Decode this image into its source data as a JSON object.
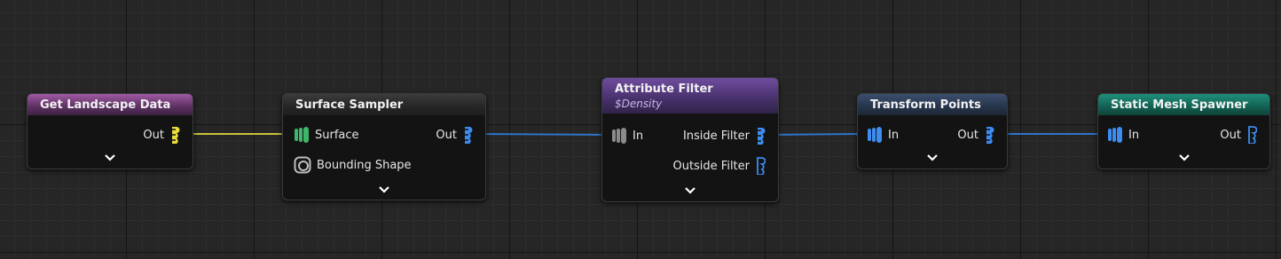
{
  "graph": {
    "nodes": [
      {
        "id": "get_landscape_data",
        "title": "Get Landscape Data",
        "header_color": "#a05aa4",
        "outputs": [
          {
            "label": "Out",
            "color": "#e8dc3a",
            "icon": "point-data-pin-icon"
          }
        ],
        "expand_icon": "chevron-down-icon"
      },
      {
        "id": "surface_sampler",
        "title": "Surface Sampler",
        "header_color": "#3b3b3b",
        "inputs": [
          {
            "label": "Surface",
            "color": "#3fb56a",
            "icon": "spatial-data-pin-icon"
          },
          {
            "label": "Bounding Shape",
            "color": "#9a9a9a",
            "icon": "bounding-shape-pin-icon"
          }
        ],
        "outputs": [
          {
            "label": "Out",
            "color": "#3d8cf0",
            "icon": "point-data-pin-icon"
          }
        ],
        "expand_icon": "chevron-down-icon"
      },
      {
        "id": "attribute_filter",
        "title": "Attribute Filter",
        "subtitle": "$Density",
        "header_color": "#6f4c9e",
        "inputs": [
          {
            "label": "In",
            "color": "#8a8a8a",
            "icon": "spatial-data-pin-icon"
          }
        ],
        "outputs": [
          {
            "label": "Inside Filter",
            "color": "#3d8cf0",
            "icon": "point-data-pin-icon"
          },
          {
            "label": "Outside Filter",
            "color": "#3d8cf0",
            "icon": "point-data-pin-icon"
          }
        ],
        "expand_icon": "chevron-down-icon"
      },
      {
        "id": "transform_points",
        "title": "Transform Points",
        "header_color": "#3b4f6e",
        "inputs": [
          {
            "label": "In",
            "color": "#3d8cf0",
            "icon": "spatial-data-pin-icon"
          }
        ],
        "outputs": [
          {
            "label": "Out",
            "color": "#3d8cf0",
            "icon": "point-data-pin-icon"
          }
        ],
        "expand_icon": "chevron-down-icon"
      },
      {
        "id": "static_mesh_spawner",
        "title": "Static Mesh Spawner",
        "header_color": "#1f8f7c",
        "inputs": [
          {
            "label": "In",
            "color": "#3d8cf0",
            "icon": "spatial-data-pin-icon"
          }
        ],
        "outputs": [
          {
            "label": "Out",
            "color": "#3d8cf0",
            "icon": "point-data-pin-icon"
          }
        ],
        "expand_icon": "chevron-down-icon"
      }
    ],
    "connections": [
      {
        "from": "get_landscape_data.Out",
        "to": "surface_sampler.Surface",
        "color": "#c9c23a"
      },
      {
        "from": "surface_sampler.Out",
        "to": "attribute_filter.In",
        "color": "#2f74c8"
      },
      {
        "from": "attribute_filter.Inside Filter",
        "to": "transform_points.In",
        "color": "#2f74c8"
      },
      {
        "from": "transform_points.Out",
        "to": "static_mesh_spawner.In",
        "color": "#2f74c8"
      }
    ]
  }
}
